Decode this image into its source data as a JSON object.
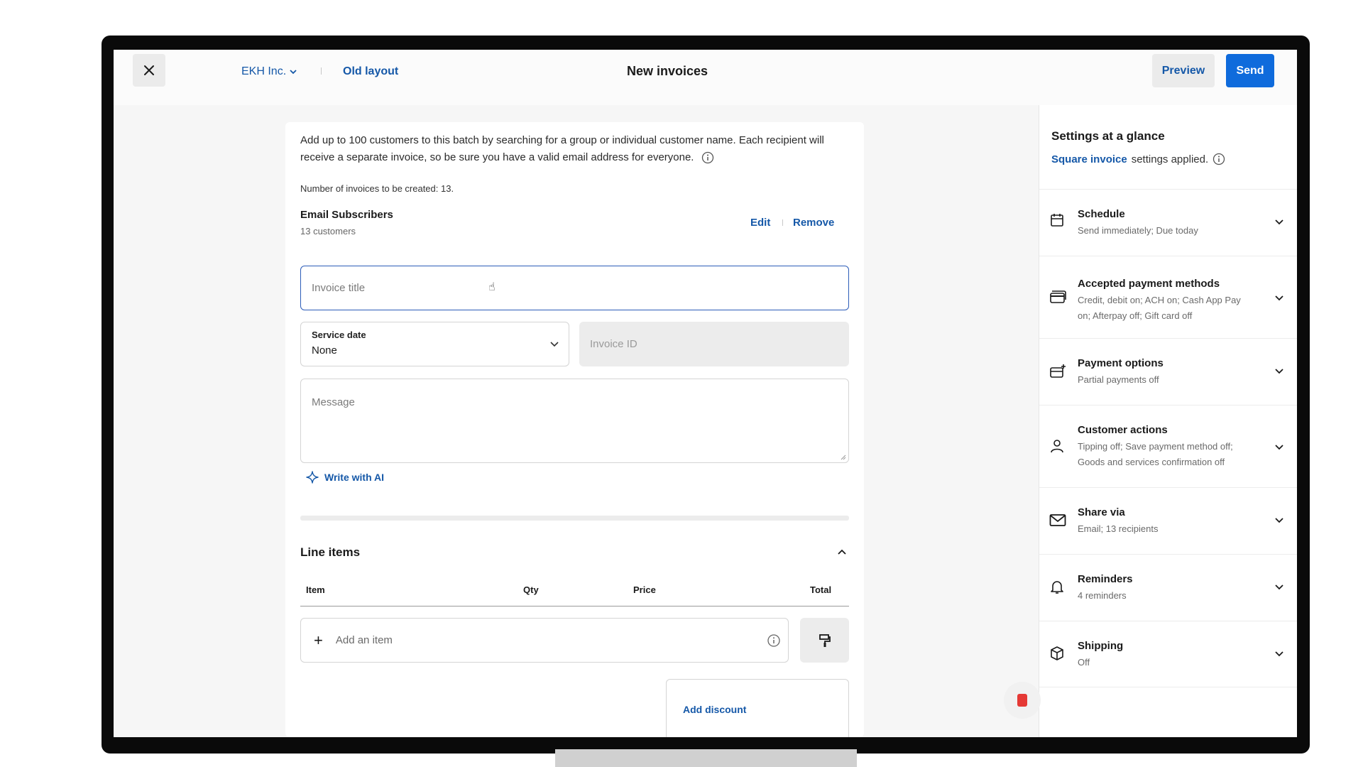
{
  "header": {
    "close_icon": "close-icon",
    "org_name": "EKH Inc.",
    "old_layout_label": "Old layout",
    "title": "New invoices",
    "preview_label": "Preview",
    "send_label": "Send"
  },
  "form": {
    "intro_text": "Add up to 100 customers to this batch by searching for a group or individual customer name. Each recipient will receive a separate invoice, so be sure you have a valid email address for everyone.",
    "invoice_count_text": "Number of invoices to be created: 13.",
    "group_name": "Email Subscribers",
    "group_count": "13 customers",
    "edit_label": "Edit",
    "remove_label": "Remove",
    "invoice_title_placeholder": "Invoice title",
    "service_date_label": "Service date",
    "service_date_value": "None",
    "invoice_id_placeholder": "Invoice ID",
    "message_placeholder": "Message",
    "write_ai_label": "Write with AI"
  },
  "line_items": {
    "title": "Line items",
    "columns": [
      "Item",
      "Qty",
      "Price",
      "Total"
    ],
    "add_item_placeholder": "Add an item",
    "add_discount_label": "Add discount"
  },
  "settings": {
    "title": "Settings at a glance",
    "applied_link": "Square invoice",
    "applied_suffix": "settings applied.",
    "rows": [
      {
        "title": "Schedule",
        "desc": "Send immediately; Due today",
        "icon": "calendar-icon"
      },
      {
        "title": "Accepted payment methods",
        "desc": "Credit, debit on; ACH on; Cash App Pay on; Afterpay off; Gift card off",
        "icon": "card-icon"
      },
      {
        "title": "Payment options",
        "desc": "Partial payments off",
        "icon": "card-plus-icon"
      },
      {
        "title": "Customer actions",
        "desc": "Tipping off; Save payment method off; Goods and services confirmation off",
        "icon": "person-icon"
      },
      {
        "title": "Share via",
        "desc": "Email; 13 recipients",
        "icon": "mail-icon"
      },
      {
        "title": "Reminders",
        "desc": "4 reminders",
        "icon": "bell-icon"
      },
      {
        "title": "Shipping",
        "desc": "Off",
        "icon": "package-icon"
      }
    ]
  },
  "colors": {
    "accent": "#1558a8",
    "primary_button": "#0f6bdc",
    "input_focus": "#2c5cb8"
  }
}
